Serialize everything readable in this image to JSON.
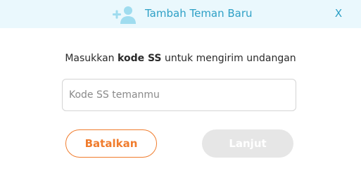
{
  "dialog": {
    "title": "Tambah Teman Baru",
    "title_icon": "add-friend-icon",
    "close_label": "X"
  },
  "instruction": {
    "before": "Masukkan ",
    "bold": "kode SS",
    "after": " untuk mengirim undangan"
  },
  "code_input": {
    "value": "",
    "placeholder": "Kode SS temanmu"
  },
  "buttons": {
    "cancel_label": "Batalkan",
    "next_label": "Lanjut",
    "next_enabled": false
  },
  "colors": {
    "header_bg": "#eaf8fd",
    "accent_blue": "#2ea0c6",
    "accent_orange": "#f07c2d",
    "disabled_bg": "#e6e6e6"
  }
}
